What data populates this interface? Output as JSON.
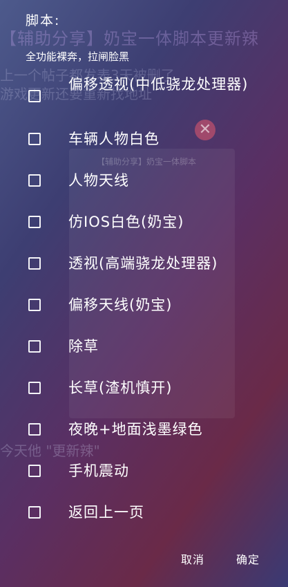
{
  "background": {
    "headline": "【辅助分享】奶宝一体脚本更新辣",
    "line1": "上一个帖子都发表3天被删了",
    "line2": "游戏更新还要重新找地址",
    "card_title": "【辅助分享】奶宝一体脚本",
    "bottom": "今天他 \"更新辣\""
  },
  "dialog": {
    "title": "脚本:",
    "subtitle": "全功能裸奔，拉闸脸黑",
    "options": [
      {
        "label": "偏移透视(中低骁龙处理器)",
        "checked": false
      },
      {
        "label": "车辆人物白色",
        "checked": false
      },
      {
        "label": "人物天线",
        "checked": false
      },
      {
        "label": "仿IOS白色(奶宝)",
        "checked": false
      },
      {
        "label": "透视(高端骁龙处理器)",
        "checked": false
      },
      {
        "label": "偏移天线(奶宝)",
        "checked": false
      },
      {
        "label": "除草",
        "checked": false
      },
      {
        "label": "长草(渣机慎开)",
        "checked": false
      },
      {
        "label": "夜晚+地面浅墨绿色",
        "checked": false
      },
      {
        "label": "手机震动",
        "checked": false
      },
      {
        "label": "返回上一页",
        "checked": false
      }
    ],
    "cancel_label": "取消",
    "confirm_label": "确定"
  },
  "icons": {
    "background_close": "close-icon"
  }
}
